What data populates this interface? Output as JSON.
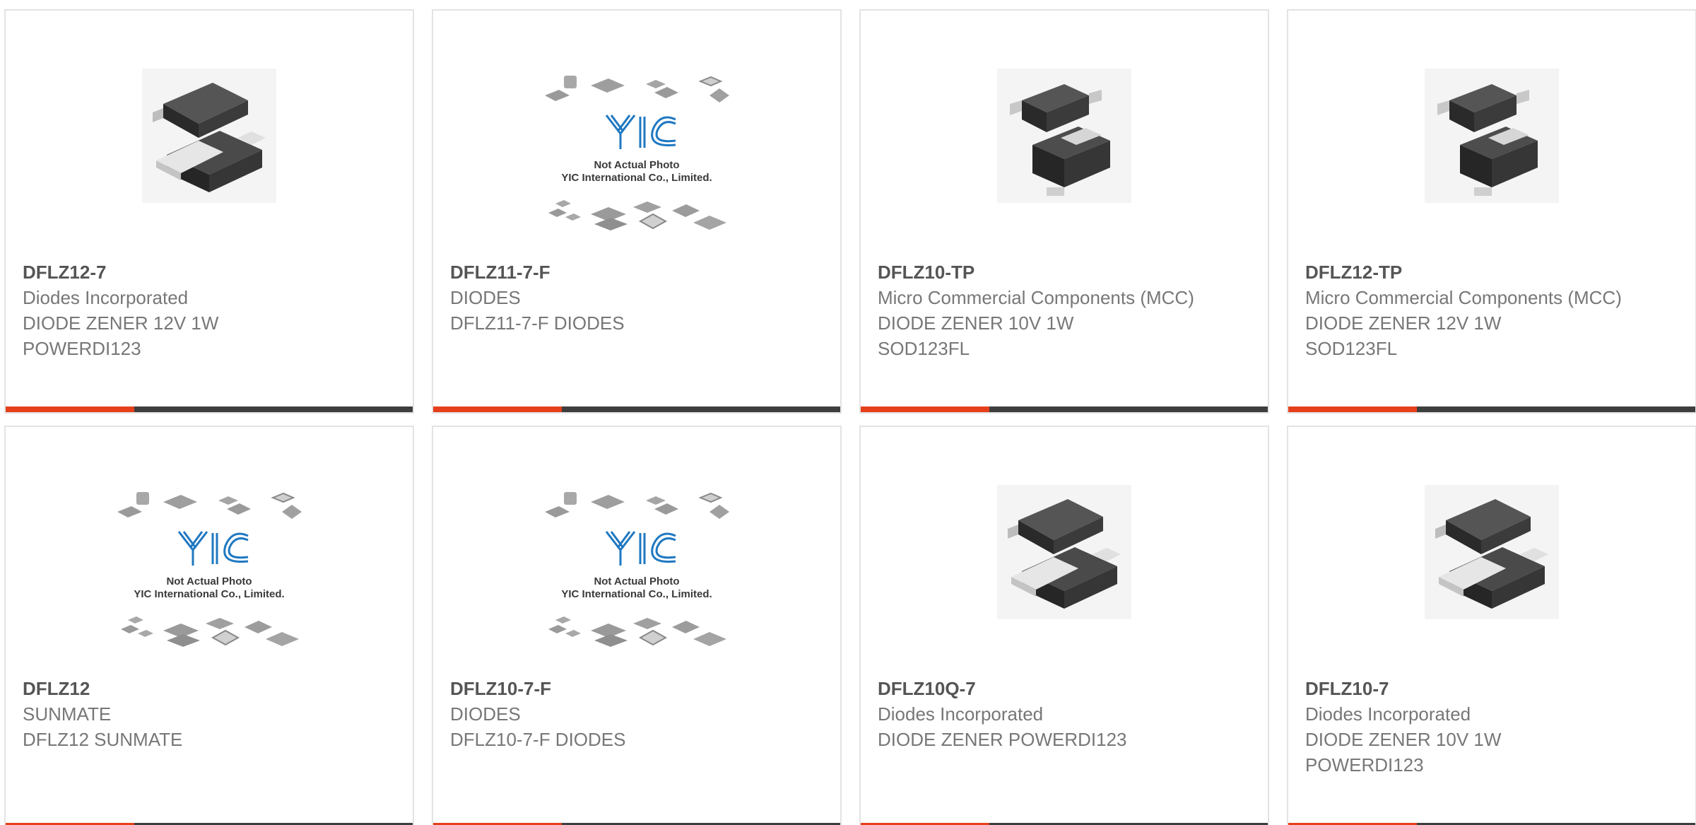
{
  "products": [
    {
      "part_number": "DFLZ12-7",
      "manufacturer": "Diodes Incorporated",
      "description_lines": [
        "DIODE ZENER 12V 1W",
        "POWERDI123"
      ],
      "image_type": "powerdi-package"
    },
    {
      "part_number": "DFLZ11-7-F",
      "manufacturer": "DIODES",
      "description_lines": [
        "DFLZ11-7-F DIODES"
      ],
      "image_type": "placeholder"
    },
    {
      "part_number": "DFLZ10-TP",
      "manufacturer": "Micro Commercial Components (MCC)",
      "description_lines": [
        "DIODE ZENER 10V 1W",
        "SOD123FL"
      ],
      "image_type": "sod123fl-package"
    },
    {
      "part_number": "DFLZ12-TP",
      "manufacturer": "Micro Commercial Components (MCC)",
      "description_lines": [
        "DIODE ZENER 12V 1W",
        "SOD123FL"
      ],
      "image_type": "sod123fl-package"
    },
    {
      "part_number": "DFLZ12",
      "manufacturer": "SUNMATE",
      "description_lines": [
        "DFLZ12 SUNMATE"
      ],
      "image_type": "placeholder"
    },
    {
      "part_number": "DFLZ10-7-F",
      "manufacturer": "DIODES",
      "description_lines": [
        "DFLZ10-7-F DIODES"
      ],
      "image_type": "placeholder"
    },
    {
      "part_number": "DFLZ10Q-7",
      "manufacturer": "Diodes Incorporated",
      "description_lines": [
        "DIODE ZENER POWERDI123"
      ],
      "image_type": "powerdi-package"
    },
    {
      "part_number": "DFLZ10-7",
      "manufacturer": "Diodes Incorporated",
      "description_lines": [
        "DIODE ZENER 10V 1W",
        "POWERDI123"
      ],
      "image_type": "powerdi-package"
    }
  ],
  "placeholder": {
    "logo_text": "YIC",
    "caption_line1": "Not Actual Photo",
    "caption_line2": "YIC International Co., Limited."
  },
  "colors": {
    "accent": "#e5401b",
    "bar": "#3e3e3e",
    "border": "#e3e3e3",
    "logo_blue": "#1f78c1"
  }
}
